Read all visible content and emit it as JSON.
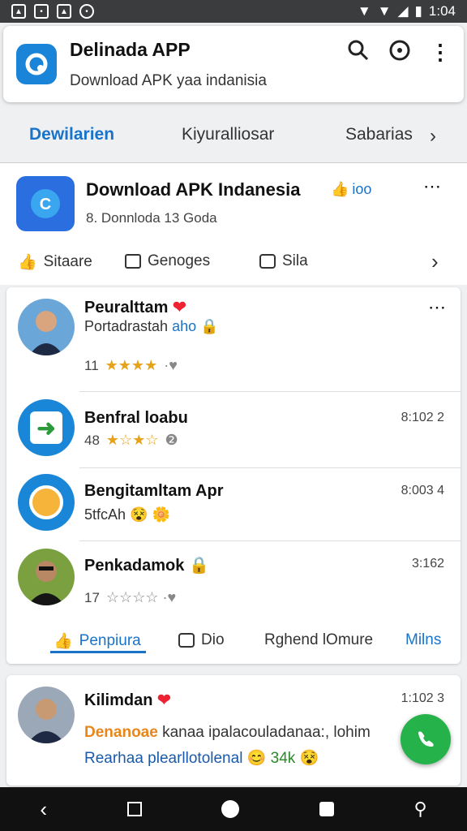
{
  "status": {
    "time": "1:04"
  },
  "appbar": {
    "title": "Delinada APP",
    "subtitle": "Download APK yaa indanisia"
  },
  "tabs": [
    "Dewilarien",
    "Kiyuralliosar",
    "Sabarias"
  ],
  "featured": {
    "title": "Download APK Indanesia",
    "link": "ioo",
    "subtitle": "8. Donnloda 13 Goda",
    "actions": [
      "Sitaare",
      "Genoges",
      "Sila"
    ]
  },
  "list": [
    {
      "name": "Peuralttam",
      "text": "Portadrastah",
      "text_accent": "aho",
      "count": "11",
      "stars": 4,
      "time": ""
    },
    {
      "name": "Benfral loabu",
      "text": "",
      "text_accent": "",
      "count": "48",
      "stars": 2,
      "time": "8:102 2"
    },
    {
      "name": "Bengitamltam Apr",
      "text": "5tfcAh",
      "text_accent": "",
      "count": "",
      "stars": 0,
      "time": "8:003 4"
    },
    {
      "name": "Penkadamok",
      "text": "",
      "text_accent": "",
      "count": "17",
      "stars": 0,
      "time": "3:162"
    }
  ],
  "bottom_actions": [
    "Penpiura",
    "Dio",
    "Rghend lOmure",
    "Milns"
  ],
  "post": {
    "name": "Kilimdan",
    "time": "1:102 3",
    "line1_accent": "Denanoae",
    "line1_rest": "kanaa ipalacouladanaa:, lohim",
    "line2": "Rearhaa plearllotolenal",
    "count": "34k"
  }
}
